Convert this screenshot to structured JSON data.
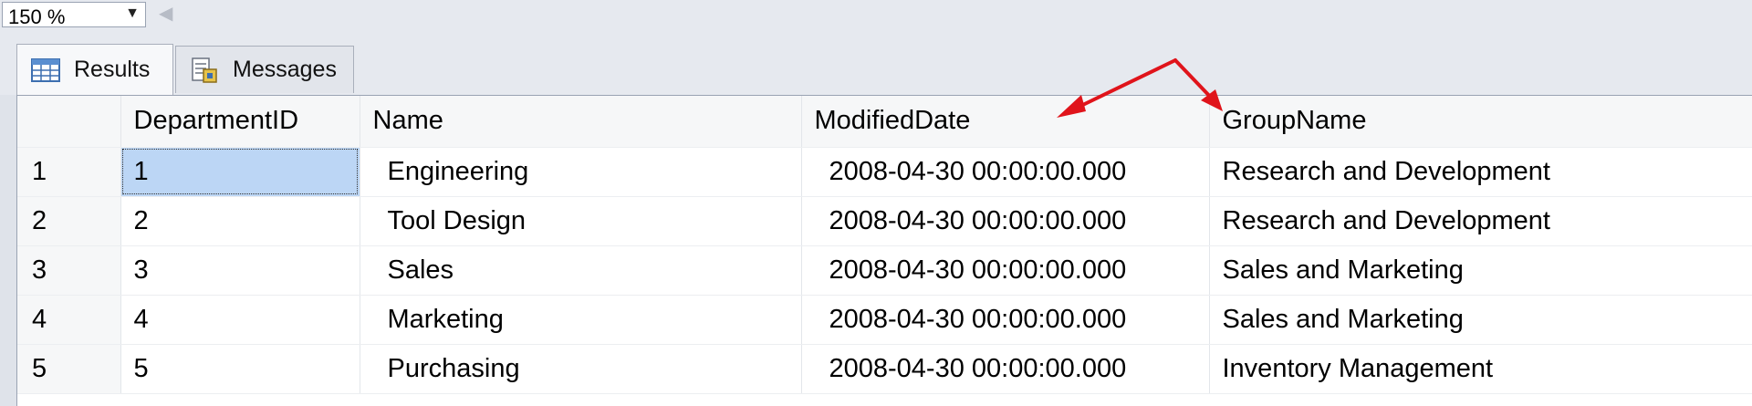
{
  "zoom": {
    "value": "150 %"
  },
  "tabs": [
    {
      "label": "Results",
      "active": true
    },
    {
      "label": "Messages",
      "active": false
    }
  ],
  "grid": {
    "columns": [
      "DepartmentID",
      "Name",
      "ModifiedDate",
      "GroupName"
    ],
    "rows": [
      {
        "rownum": "1",
        "cells": [
          "1",
          "Engineering",
          "2008-04-30 00:00:00.000",
          "Research and Development"
        ]
      },
      {
        "rownum": "2",
        "cells": [
          "2",
          "Tool Design",
          "2008-04-30 00:00:00.000",
          "Research and Development"
        ]
      },
      {
        "rownum": "3",
        "cells": [
          "3",
          "Sales",
          "2008-04-30 00:00:00.000",
          "Sales and Marketing"
        ]
      },
      {
        "rownum": "4",
        "cells": [
          "4",
          "Marketing",
          "2008-04-30 00:00:00.000",
          "Sales and Marketing"
        ]
      },
      {
        "rownum": "5",
        "cells": [
          "5",
          "Purchasing",
          "2008-04-30 00:00:00.000",
          "Inventory Management"
        ]
      }
    ]
  },
  "colors": {
    "selection": "#bcd6f5",
    "annotation": "#e0141b"
  },
  "icons": {
    "results": "grid-table-icon",
    "messages": "document-messages-icon",
    "zoom_dropdown": "chevron-down-icon"
  }
}
